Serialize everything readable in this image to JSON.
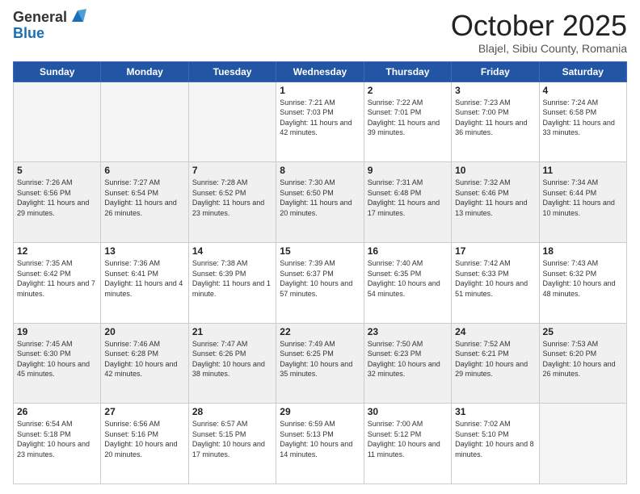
{
  "header": {
    "logo_general": "General",
    "logo_blue": "Blue",
    "title": "October 2025",
    "subtitle": "Blajel, Sibiu County, Romania"
  },
  "days_of_week": [
    "Sunday",
    "Monday",
    "Tuesday",
    "Wednesday",
    "Thursday",
    "Friday",
    "Saturday"
  ],
  "weeks": [
    [
      {
        "day": "",
        "sunrise": "",
        "sunset": "",
        "daylight": "",
        "empty": true
      },
      {
        "day": "",
        "sunrise": "",
        "sunset": "",
        "daylight": "",
        "empty": true
      },
      {
        "day": "",
        "sunrise": "",
        "sunset": "",
        "daylight": "",
        "empty": true
      },
      {
        "day": "1",
        "sunrise": "Sunrise: 7:21 AM",
        "sunset": "Sunset: 7:03 PM",
        "daylight": "Daylight: 11 hours and 42 minutes.",
        "empty": false
      },
      {
        "day": "2",
        "sunrise": "Sunrise: 7:22 AM",
        "sunset": "Sunset: 7:01 PM",
        "daylight": "Daylight: 11 hours and 39 minutes.",
        "empty": false
      },
      {
        "day": "3",
        "sunrise": "Sunrise: 7:23 AM",
        "sunset": "Sunset: 7:00 PM",
        "daylight": "Daylight: 11 hours and 36 minutes.",
        "empty": false
      },
      {
        "day": "4",
        "sunrise": "Sunrise: 7:24 AM",
        "sunset": "Sunset: 6:58 PM",
        "daylight": "Daylight: 11 hours and 33 minutes.",
        "empty": false
      }
    ],
    [
      {
        "day": "5",
        "sunrise": "Sunrise: 7:26 AM",
        "sunset": "Sunset: 6:56 PM",
        "daylight": "Daylight: 11 hours and 29 minutes.",
        "empty": false
      },
      {
        "day": "6",
        "sunrise": "Sunrise: 7:27 AM",
        "sunset": "Sunset: 6:54 PM",
        "daylight": "Daylight: 11 hours and 26 minutes.",
        "empty": false
      },
      {
        "day": "7",
        "sunrise": "Sunrise: 7:28 AM",
        "sunset": "Sunset: 6:52 PM",
        "daylight": "Daylight: 11 hours and 23 minutes.",
        "empty": false
      },
      {
        "day": "8",
        "sunrise": "Sunrise: 7:30 AM",
        "sunset": "Sunset: 6:50 PM",
        "daylight": "Daylight: 11 hours and 20 minutes.",
        "empty": false
      },
      {
        "day": "9",
        "sunrise": "Sunrise: 7:31 AM",
        "sunset": "Sunset: 6:48 PM",
        "daylight": "Daylight: 11 hours and 17 minutes.",
        "empty": false
      },
      {
        "day": "10",
        "sunrise": "Sunrise: 7:32 AM",
        "sunset": "Sunset: 6:46 PM",
        "daylight": "Daylight: 11 hours and 13 minutes.",
        "empty": false
      },
      {
        "day": "11",
        "sunrise": "Sunrise: 7:34 AM",
        "sunset": "Sunset: 6:44 PM",
        "daylight": "Daylight: 11 hours and 10 minutes.",
        "empty": false
      }
    ],
    [
      {
        "day": "12",
        "sunrise": "Sunrise: 7:35 AM",
        "sunset": "Sunset: 6:42 PM",
        "daylight": "Daylight: 11 hours and 7 minutes.",
        "empty": false
      },
      {
        "day": "13",
        "sunrise": "Sunrise: 7:36 AM",
        "sunset": "Sunset: 6:41 PM",
        "daylight": "Daylight: 11 hours and 4 minutes.",
        "empty": false
      },
      {
        "day": "14",
        "sunrise": "Sunrise: 7:38 AM",
        "sunset": "Sunset: 6:39 PM",
        "daylight": "Daylight: 11 hours and 1 minute.",
        "empty": false
      },
      {
        "day": "15",
        "sunrise": "Sunrise: 7:39 AM",
        "sunset": "Sunset: 6:37 PM",
        "daylight": "Daylight: 10 hours and 57 minutes.",
        "empty": false
      },
      {
        "day": "16",
        "sunrise": "Sunrise: 7:40 AM",
        "sunset": "Sunset: 6:35 PM",
        "daylight": "Daylight: 10 hours and 54 minutes.",
        "empty": false
      },
      {
        "day": "17",
        "sunrise": "Sunrise: 7:42 AM",
        "sunset": "Sunset: 6:33 PM",
        "daylight": "Daylight: 10 hours and 51 minutes.",
        "empty": false
      },
      {
        "day": "18",
        "sunrise": "Sunrise: 7:43 AM",
        "sunset": "Sunset: 6:32 PM",
        "daylight": "Daylight: 10 hours and 48 minutes.",
        "empty": false
      }
    ],
    [
      {
        "day": "19",
        "sunrise": "Sunrise: 7:45 AM",
        "sunset": "Sunset: 6:30 PM",
        "daylight": "Daylight: 10 hours and 45 minutes.",
        "empty": false
      },
      {
        "day": "20",
        "sunrise": "Sunrise: 7:46 AM",
        "sunset": "Sunset: 6:28 PM",
        "daylight": "Daylight: 10 hours and 42 minutes.",
        "empty": false
      },
      {
        "day": "21",
        "sunrise": "Sunrise: 7:47 AM",
        "sunset": "Sunset: 6:26 PM",
        "daylight": "Daylight: 10 hours and 38 minutes.",
        "empty": false
      },
      {
        "day": "22",
        "sunrise": "Sunrise: 7:49 AM",
        "sunset": "Sunset: 6:25 PM",
        "daylight": "Daylight: 10 hours and 35 minutes.",
        "empty": false
      },
      {
        "day": "23",
        "sunrise": "Sunrise: 7:50 AM",
        "sunset": "Sunset: 6:23 PM",
        "daylight": "Daylight: 10 hours and 32 minutes.",
        "empty": false
      },
      {
        "day": "24",
        "sunrise": "Sunrise: 7:52 AM",
        "sunset": "Sunset: 6:21 PM",
        "daylight": "Daylight: 10 hours and 29 minutes.",
        "empty": false
      },
      {
        "day": "25",
        "sunrise": "Sunrise: 7:53 AM",
        "sunset": "Sunset: 6:20 PM",
        "daylight": "Daylight: 10 hours and 26 minutes.",
        "empty": false
      }
    ],
    [
      {
        "day": "26",
        "sunrise": "Sunrise: 6:54 AM",
        "sunset": "Sunset: 5:18 PM",
        "daylight": "Daylight: 10 hours and 23 minutes.",
        "empty": false
      },
      {
        "day": "27",
        "sunrise": "Sunrise: 6:56 AM",
        "sunset": "Sunset: 5:16 PM",
        "daylight": "Daylight: 10 hours and 20 minutes.",
        "empty": false
      },
      {
        "day": "28",
        "sunrise": "Sunrise: 6:57 AM",
        "sunset": "Sunset: 5:15 PM",
        "daylight": "Daylight: 10 hours and 17 minutes.",
        "empty": false
      },
      {
        "day": "29",
        "sunrise": "Sunrise: 6:59 AM",
        "sunset": "Sunset: 5:13 PM",
        "daylight": "Daylight: 10 hours and 14 minutes.",
        "empty": false
      },
      {
        "day": "30",
        "sunrise": "Sunrise: 7:00 AM",
        "sunset": "Sunset: 5:12 PM",
        "daylight": "Daylight: 10 hours and 11 minutes.",
        "empty": false
      },
      {
        "day": "31",
        "sunrise": "Sunrise: 7:02 AM",
        "sunset": "Sunset: 5:10 PM",
        "daylight": "Daylight: 10 hours and 8 minutes.",
        "empty": false
      },
      {
        "day": "",
        "sunrise": "",
        "sunset": "",
        "daylight": "",
        "empty": true
      }
    ]
  ]
}
